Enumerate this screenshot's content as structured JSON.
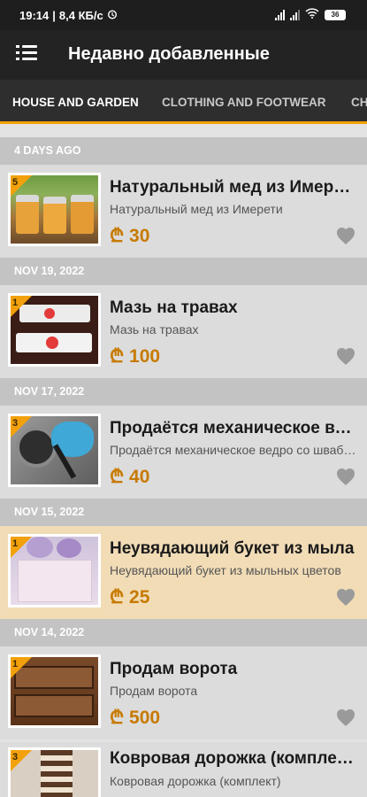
{
  "status": {
    "time": "19:14",
    "speed": "8,4 КБ/с",
    "battery": "36"
  },
  "appbar": {
    "title": "Недавно добавленные"
  },
  "tabs": [
    {
      "label": "HOUSE AND GARDEN",
      "active": true
    },
    {
      "label": "CLOTHING AND FOOTWEAR",
      "active": false
    },
    {
      "label": "CH",
      "active": false
    }
  ],
  "colors": {
    "accent": "#f0a000",
    "price": "#c77a00",
    "featured_bg": "#f1dcb6"
  },
  "sections": [
    {
      "date": "4 DAYS AGO"
    },
    {
      "date": "NOV 19, 2022"
    },
    {
      "date": "NOV 17, 2022"
    },
    {
      "date": "NOV 15, 2022"
    },
    {
      "date": "NOV 14, 2022"
    }
  ],
  "items": [
    {
      "badge": "5",
      "title": "Натуральный мед из Имерети",
      "subtitle": "Натуральный мед из Имерети",
      "currency": "₾",
      "price": "30",
      "featured": false
    },
    {
      "badge": "1",
      "title": "Мазь на травах",
      "subtitle": "Мазь на травах",
      "currency": "₾",
      "price": "100",
      "featured": false
    },
    {
      "badge": "3",
      "title": "Продаётся механическое ведро",
      "subtitle": "Продаётся механическое ведро со швабрами",
      "currency": "₾",
      "price": "40",
      "featured": false
    },
    {
      "badge": "1",
      "title": "Неувядающий букет из мыла",
      "subtitle": "Неувядающий букет из мыльных цветов",
      "currency": "₾",
      "price": "25",
      "featured": true
    },
    {
      "badge": "1",
      "title": "Продам ворота",
      "subtitle": "Продам ворота",
      "currency": "₾",
      "price": "500",
      "featured": false
    },
    {
      "badge": "3",
      "title": "Ковровая дорожка (комплект)",
      "subtitle": "Ковровая дорожка (комплект)",
      "currency": "",
      "price": "",
      "featured": false
    }
  ]
}
